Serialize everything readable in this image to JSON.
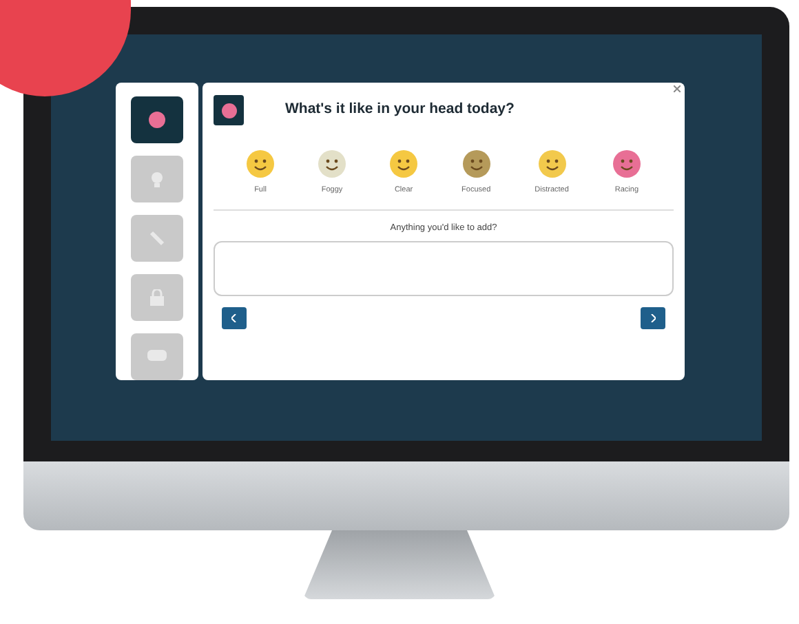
{
  "sidebar": {
    "items": [
      {
        "selected": true
      },
      {
        "selected": false
      },
      {
        "selected": false
      },
      {
        "selected": false
      },
      {
        "selected": false
      }
    ]
  },
  "prompt": {
    "title": "What's it like in your head today?"
  },
  "moods": [
    {
      "label": "Full",
      "color": "#f5c842"
    },
    {
      "label": "Foggy",
      "color": "#e3e0c8"
    },
    {
      "label": "Clear",
      "color": "#f5c842"
    },
    {
      "label": "Focused",
      "color": "#b59a5a"
    },
    {
      "label": "Distracted",
      "color": "#f2c94c"
    },
    {
      "label": "Racing",
      "color": "#e86f95"
    }
  ],
  "note": {
    "label": "Anything you'd like to add?"
  }
}
